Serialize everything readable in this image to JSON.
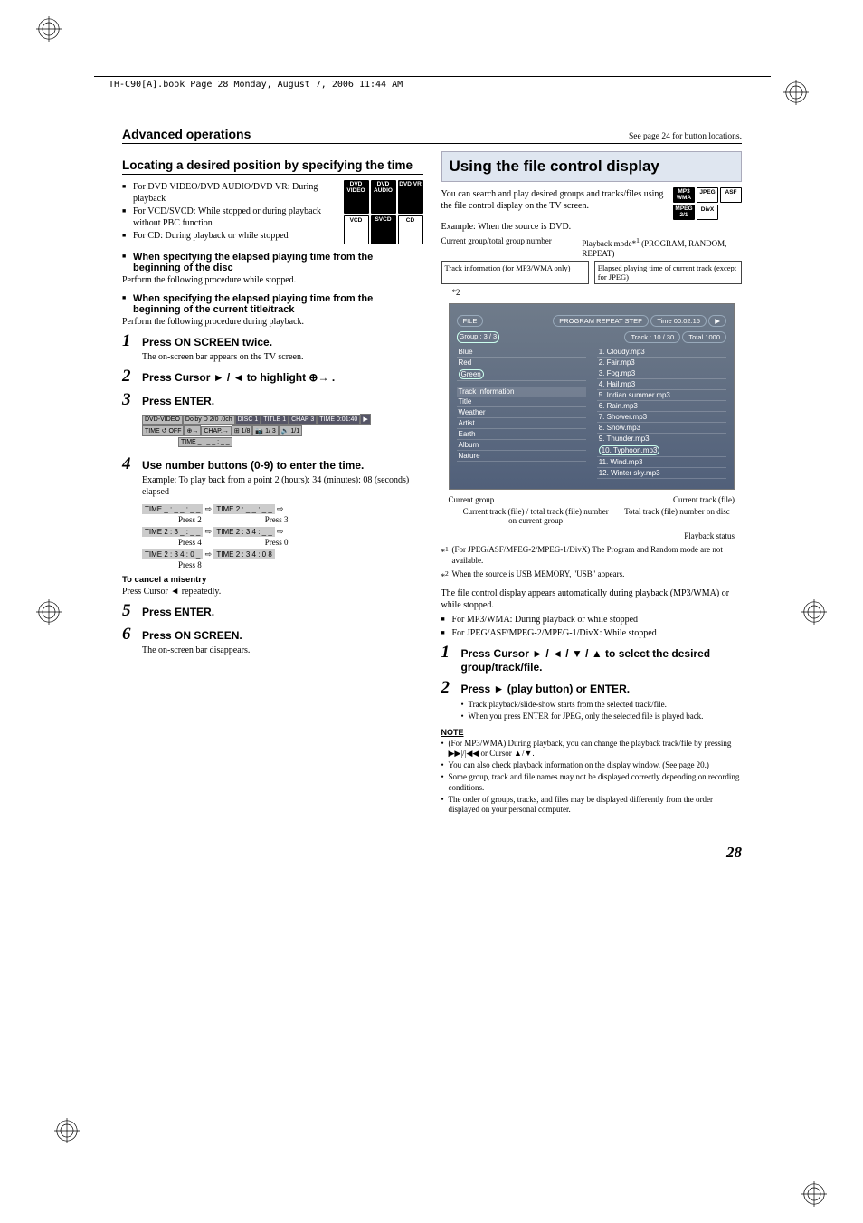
{
  "header_line": "TH-C90[A].book  Page 28  Monday, August 7, 2006  11:44 AM",
  "page_number": "28",
  "left": {
    "section_title": "Advanced operations",
    "section_note": "See page 24 for button locations.",
    "h2": "Locating a desired position by specifying the time",
    "badges_l": [
      "DVD VIDEO",
      "DVD AUDIO",
      "DVD VR",
      "VCD",
      "SVCD",
      "CD"
    ],
    "disc_notes": [
      "For DVD VIDEO/DVD AUDIO/DVD VR: During playback",
      "For VCD/SVCD: While stopped or during playback without PBC function",
      "For CD: During playback or while stopped"
    ],
    "sub1": "When specifying the elapsed playing time from the beginning of the disc",
    "sub1_p": "Perform the following procedure while stopped.",
    "sub2": "When specifying the elapsed playing time from the beginning of the current title/track",
    "sub2_p": "Perform the following procedure during playback.",
    "step1": "Press ON SCREEN twice.",
    "step1_sub": "The on-screen bar appears on the TV screen.",
    "step2": "Press Cursor ► / ◄ to highlight ⊕→ .",
    "step3": "Press ENTER.",
    "osd_row1": [
      "DVD-VIDEO",
      "Dolby D 2/0 .0ch",
      "DISC 1",
      "TITLE  1",
      "CHAP  3",
      "TIME   0:01:40",
      "▶"
    ],
    "osd_row2": [
      "TIME ↺ OFF",
      "⊕→",
      "CHAP.→",
      "⊞ 1/8",
      "📷 1/ 3",
      "🔊 1/1"
    ],
    "osd_row3": "TIME  _ : _ _ : _ _",
    "step4": "Use number buttons (0-9) to enter the time.",
    "step4_ex": "Example: To play back from a point 2 (hours): 34 (minutes): 08 (seconds) elapsed",
    "time_seq": [
      {
        "a": "TIME  _ : _ _ : _ _",
        "arrow": "⇨",
        "b": "TIME  2 : _ _ : _ _",
        "arrow2": "⇨",
        "pa": "Press 2",
        "pb": "Press 3"
      },
      {
        "a": "TIME  2 : 3 _ : _ _",
        "arrow": "⇨",
        "b": "TIME  2 : 3 4 : _ _",
        "arrow2": "⇨",
        "pa": "Press 4",
        "pb": "Press 0"
      },
      {
        "a": "TIME  2 : 3 4 : 0 _",
        "arrow": "⇨",
        "b": "TIME  2 : 3 4 : 0 8",
        "arrow2": "",
        "pa": "Press 8",
        "pb": ""
      }
    ],
    "cancel_hd": "To cancel a misentry",
    "cancel_p": "Press Cursor ◄ repeatedly.",
    "step5": "Press ENTER.",
    "step6": "Press ON SCREEN.",
    "step6_sub": "The on-screen bar disappears."
  },
  "right": {
    "box_title": "Using the file control display",
    "intro": "You can search and play desired groups and tracks/files using the file control display on the TV screen.",
    "example": "Example: When the source is DVD.",
    "badges_r": [
      "MP3 WMA",
      "JPEG",
      "ASF",
      "MPEG 2/1",
      "DivX"
    ],
    "annot_top_left": "Current group/total group number",
    "annot_top_right_a": "Playback mode*",
    "annot_top_right_sup": "1",
    "annot_top_right_b": " (PROGRAM, RANDOM, REPEAT)",
    "annot_cell_left": "Track information (for MP3/WMA only)",
    "annot_cell_right": "Elapsed playing time of current track (except for JPEG)",
    "annot_ast2": "*2",
    "fcd": {
      "file_chip": "FILE",
      "mode_chip": "PROGRAM  REPEAT STEP",
      "time_chip": "Time 00:02:15",
      "play_icon": "▶",
      "group_chip": "Group :   3  /  3",
      "track_chip": "Track :  10  /  30",
      "total_chip": "Total  1000",
      "groups": [
        "Blue",
        "Red",
        "Green"
      ],
      "info_hd": "Track  Information",
      "info": [
        "Title",
        "Weather",
        "Artist",
        "Earth",
        "Album",
        "Nature"
      ],
      "tracks": [
        "1. Cloudy.mp3",
        "2. Fair.mp3",
        "3. Fog.mp3",
        "4. Hail.mp3",
        "5. Indian summer.mp3",
        "6. Rain.mp3",
        "7. Shower.mp3",
        "8. Snow.mp3",
        "9. Thunder.mp3",
        "10. Typhoon.mp3",
        "11. Wind.mp3",
        "12. Winter sky.mp3"
      ]
    },
    "annot_btm_left": "Current group",
    "annot_btm_right": "Current track (file)",
    "annot_line2_left": "Current track (file) / total track (file) number on current group",
    "annot_line2_right": "Total track (file) number on disc",
    "annot_status": "Playback status",
    "fn1": "(For JPEG/ASF/MPEG-2/MPEG-1/DivX) The Program and Random mode are not available.",
    "fn2": "When the source is USB MEMORY, \"USB\" appears.",
    "auto_p": "The file control display appears automatically during playback (MP3/WMA) or while stopped.",
    "modes": [
      "For MP3/WMA: During playback or while stopped",
      "For JPEG/ASF/MPEG-2/MPEG-1/DivX: While stopped"
    ],
    "step1": "Press Cursor ► / ◄ / ▼ / ▲ to select the desired group/track/file.",
    "step2": "Press ► (play button) or ENTER.",
    "step2_sub": [
      "Track playback/slide-show starts from the selected track/file.",
      "When you press ENTER for JPEG, only the selected file is played back."
    ],
    "note_hd": "NOTE",
    "notes": [
      "(For MP3/WMA) During playback, you can change the playback track/file by pressing ▶▶|/|◀◀ or Cursor ▲/▼.",
      "You can also check playback information on the display window. (See page 20.)",
      "Some group, track and file names may not be displayed correctly depending on recording conditions.",
      "The order of groups, tracks, and files may be displayed differently from the order displayed on your personal computer."
    ]
  }
}
